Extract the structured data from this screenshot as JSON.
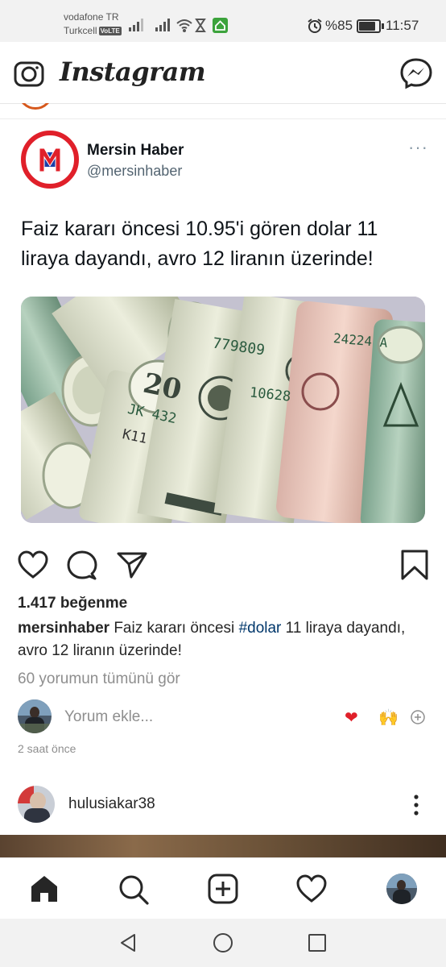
{
  "status_bar": {
    "carrier1": "vodafone TR",
    "carrier2": "Turkcell",
    "volte": "VoLTE",
    "battery": "%85",
    "time": "11:57"
  },
  "header": {
    "title": "Instagram",
    "icons": [
      "camera-icon",
      "messenger-icon"
    ]
  },
  "post": {
    "tweet_card": {
      "name": "Mersin Haber",
      "handle": "@mersinhaber",
      "text": "Faiz kararı öncesi 10.95'i gören dolar 11 liraya dayandı, avro 12 liranın üzerinde!",
      "image_labels": [
        "779809",
        "10628",
        "24224 A",
        "JK 432",
        "K11",
        "20"
      ]
    },
    "likes": "1.417 beğenme",
    "caption_user": "mersinhaber",
    "caption_pre": "Faiz kararı öncesi",
    "caption_hashtag": "#dolar",
    "caption_post": "11 liraya dayandı, avro 12 liranın üzerinde!",
    "view_comments": "60 yorumun tümünü gör",
    "comment_placeholder": "Yorum ekle...",
    "quick_reactions": [
      "❤️",
      "🙌"
    ],
    "timestamp": "2 saat önce"
  },
  "next_post": {
    "username": "hulusiakar38"
  },
  "bottom_nav": [
    "home-icon",
    "search-icon",
    "add-post-icon",
    "activity-icon",
    "profile-avatar"
  ],
  "colors": {
    "accent_red": "#e0202a",
    "hashtag": "#00376b",
    "muted": "#8e8e8e"
  }
}
